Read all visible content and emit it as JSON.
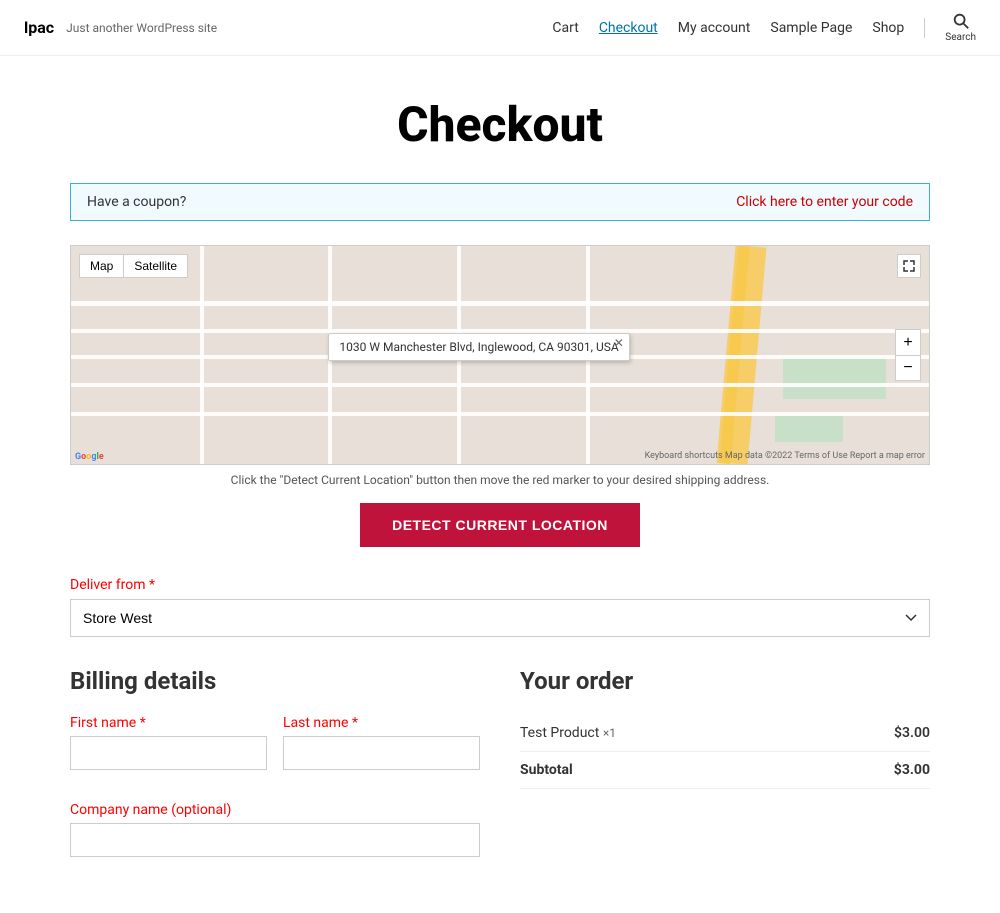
{
  "header": {
    "site_name": "lpac",
    "site_tagline": "Just another WordPress site",
    "nav": [
      {
        "label": "Cart",
        "active": false
      },
      {
        "label": "Checkout",
        "active": true
      },
      {
        "label": "My account",
        "active": false
      },
      {
        "label": "Sample Page",
        "active": false
      },
      {
        "label": "Shop",
        "active": false
      }
    ],
    "search_label": "Search"
  },
  "page_title": "Checkout",
  "coupon": {
    "text": "Have a coupon?",
    "link_text": "Click here to enter your code"
  },
  "map": {
    "tab_map": "Map",
    "tab_satellite": "Satellite",
    "popup_address": "1030 W Manchester Blvd, Inglewood, CA 90301, USA",
    "instruction": "Click the \"Detect Current Location\" button then move the red marker to your desired shipping address.",
    "footer_text": "Keyboard shortcuts   Map data ©2022   Terms of Use   Report a map error"
  },
  "detect_button": "DETECT CURRENT LOCATION",
  "deliver_from": {
    "label": "Deliver from",
    "required": true,
    "options": [
      "Store West"
    ],
    "selected": "Store West"
  },
  "billing": {
    "title": "Billing details",
    "fields": [
      {
        "label": "First name",
        "required": true,
        "name": "first-name"
      },
      {
        "label": "Last name",
        "required": true,
        "name": "last-name"
      },
      {
        "label": "Company name (optional)",
        "required": false,
        "name": "company"
      }
    ]
  },
  "order": {
    "title": "Your order",
    "items": [
      {
        "name": "Test Product",
        "qty": "×1",
        "price": "$3.00"
      }
    ],
    "subtotal_label": "Subtotal",
    "subtotal_value": "$3.00"
  }
}
